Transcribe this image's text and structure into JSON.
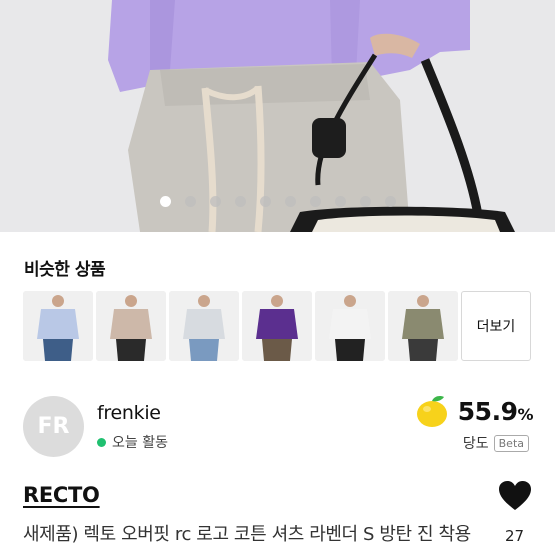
{
  "hero": {
    "image_alt": "",
    "carousel_pages": 10,
    "active_page": 1
  },
  "similar": {
    "title": "비슷한 상품",
    "items": [
      {
        "shirt_color": "#b9c8e6",
        "pants_color": "#3e5e88"
      },
      {
        "shirt_color": "#cdb8a9",
        "pants_color": "#2a2a2a"
      },
      {
        "shirt_color": "#d7dbe0",
        "pants_color": "#7a9ac0"
      },
      {
        "shirt_color": "#5b2f8f",
        "pants_color": "#6b5a48"
      },
      {
        "shirt_color": "#f3f3f3",
        "pants_color": "#222222"
      },
      {
        "shirt_color": "#8a8a70",
        "pants_color": "#3a3a3a"
      }
    ],
    "more_label": "더보기"
  },
  "seller": {
    "avatar_initials": "FR",
    "name": "frenkie",
    "status": "오늘 활동",
    "status_color": "#20c070",
    "trust_value": "55.9",
    "trust_unit": "%",
    "trust_label": "당도",
    "beta_label": "Beta",
    "trust_icon": "lemon-icon"
  },
  "product": {
    "brand": "RECTO",
    "title": "새제품) 렉토 오버핏 rc 로고 코튼 셔츠 라벤더 S 방탄 진 착용",
    "like_count": "27",
    "like_icon": "heart-icon"
  }
}
